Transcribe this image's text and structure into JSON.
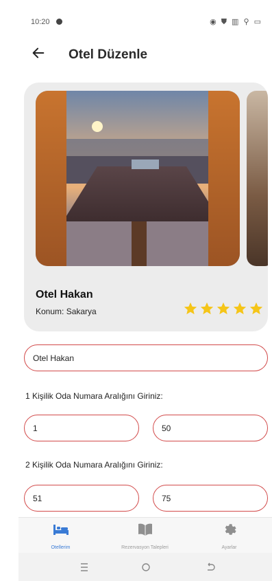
{
  "status": {
    "time": "10:20",
    "icons": "◉ ⛊ ▥ ⚲ ▭"
  },
  "appbar": {
    "title": "Otel Düzenle"
  },
  "hotel": {
    "name": "Otel Hakan",
    "location": "Konum: Sakarya",
    "rating": 5
  },
  "form": {
    "name_value": "Otel Hakan",
    "single_label": "1 Kişilik Oda Numara Aralığını Giriniz:",
    "single_from": "1",
    "single_to": "50",
    "double_label": "2 Kişilik Oda Numara Aralığını Giriniz:",
    "double_from": "51",
    "double_to": "75"
  },
  "nav": {
    "items": [
      {
        "label": "Otellerim",
        "icon": "bed-icon",
        "active": true
      },
      {
        "label": "Rezervasyon Talepleri",
        "icon": "book-icon",
        "active": false
      },
      {
        "label": "Ayarlar",
        "icon": "gear-icon",
        "active": false
      }
    ]
  },
  "colors": {
    "accent": "#3a7bd5",
    "field_border": "#d24a4a",
    "star": "#f5c518",
    "card_bg": "#ececec"
  }
}
